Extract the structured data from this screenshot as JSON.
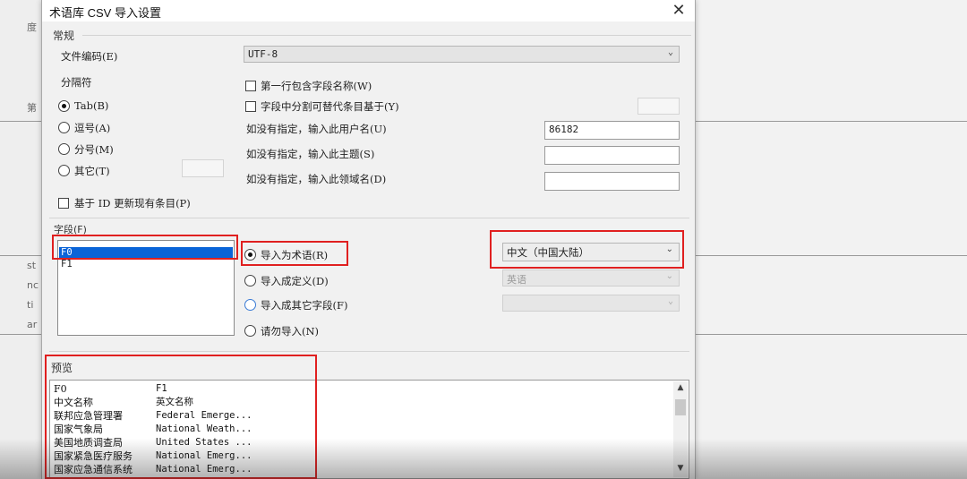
{
  "background": {
    "left_glyphs": [
      "度",
      "第",
      "st",
      "nc",
      "ti",
      "ar"
    ]
  },
  "dialog": {
    "title": "术语库 CSV 导入设置",
    "close_label": "✕"
  },
  "general": {
    "group_label": "常规",
    "encoding_label": "文件编码(E)",
    "encoding_value": "UTF-8",
    "separator_label": "分隔符",
    "separators": [
      {
        "label": "Tab(B)",
        "checked": true
      },
      {
        "label": "逗号(A)",
        "checked": false
      },
      {
        "label": "分号(M)",
        "checked": false
      },
      {
        "label": "其它(T)",
        "checked": false
      }
    ],
    "first_row_label": "第一行包含字段名称(W)",
    "split_label": "字段中分割可替代条目基于(Y)",
    "username_label": "如没有指定，输入此用户名(U)",
    "username_value": "86182",
    "subject_label": "如没有指定，输入此主题(S)",
    "subject_value": "",
    "domain_label": "如没有指定，输入此领域名(D)",
    "domain_value": "",
    "update_label": "基于 ID 更新现有条目(P)"
  },
  "fields": {
    "group_label": "字段(F)",
    "items": [
      "F0",
      "F1"
    ],
    "selected_index": 0,
    "import_options": [
      {
        "label": "导入为术语(R)",
        "checked": true
      },
      {
        "label": "导入成定义(D)",
        "checked": false
      },
      {
        "label": "导入成其它字段(F)",
        "checked": false
      },
      {
        "label": "请勿导入(N)",
        "checked": false
      }
    ],
    "language_value": "中文（中国大陆）",
    "definition_lang_value": "英语",
    "other_field_value": ""
  },
  "preview": {
    "group_label": "预览",
    "rows": [
      [
        "F0",
        "F1"
      ],
      [
        "中文名称",
        "英文名称"
      ],
      [
        "联邦应急管理署",
        "Federal Emerge..."
      ],
      [
        "国家气象局",
        "National Weath..."
      ],
      [
        "美国地质调查局",
        "United States ..."
      ],
      [
        "国家紧急医疗服务",
        "National Emerg..."
      ],
      [
        "国家应急通信系统",
        "National Emerg..."
      ]
    ]
  },
  "colors": {
    "highlight_red": "#e02020",
    "selection_blue": "#0a64d8"
  }
}
